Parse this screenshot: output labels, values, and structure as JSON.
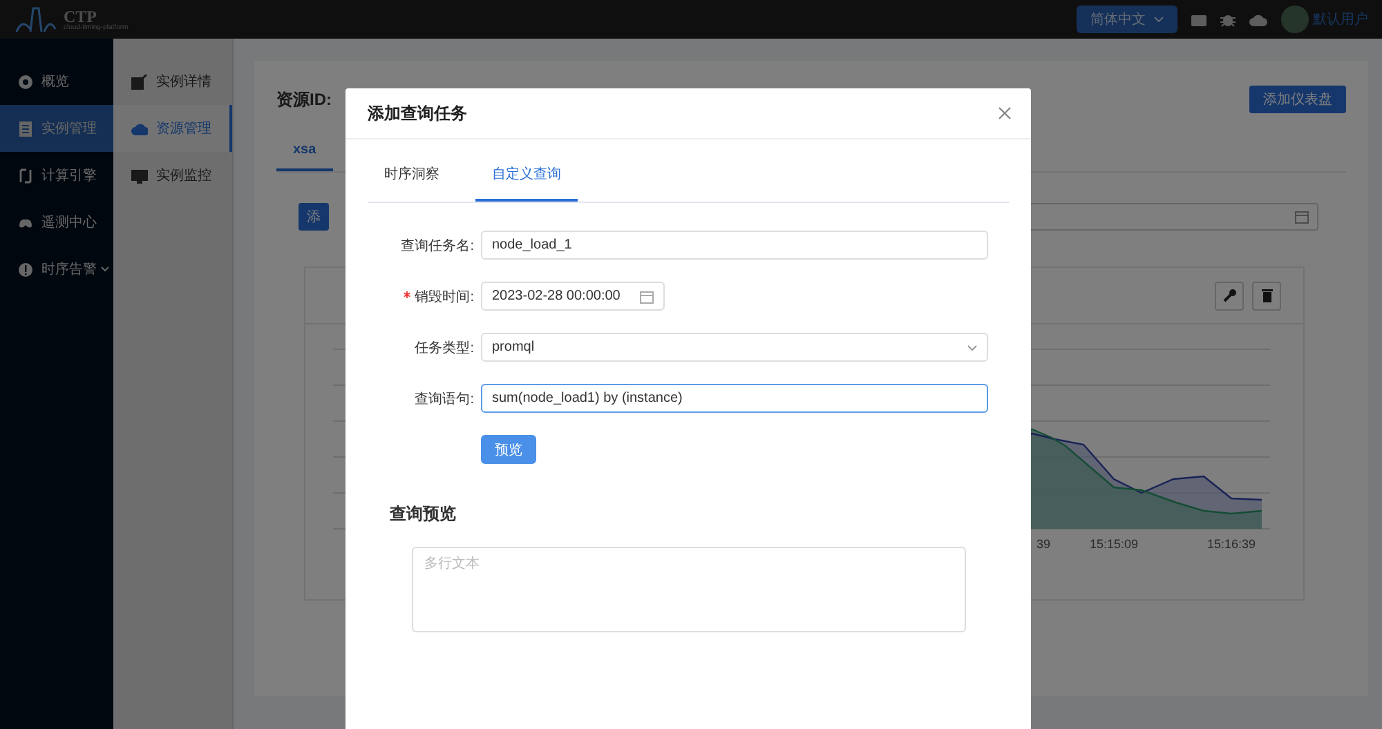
{
  "header": {
    "logo": {
      "title": "CTP",
      "subtitle": "cloud-timing-platform"
    },
    "language": "简体中文",
    "user": "默认用户"
  },
  "sidebar": {
    "items": [
      {
        "label": "概览",
        "selected": false,
        "has_submenu": false
      },
      {
        "label": "实例管理",
        "selected": true,
        "has_submenu": false
      },
      {
        "label": "计算引擎",
        "selected": false,
        "has_submenu": false
      },
      {
        "label": "遥测中心",
        "selected": false,
        "has_submenu": false
      },
      {
        "label": "时序告警",
        "selected": false,
        "has_submenu": true
      }
    ]
  },
  "subnav": {
    "items": [
      {
        "label": "实例详情",
        "selected": false
      },
      {
        "label": "资源管理",
        "selected": true
      },
      {
        "label": "实例监控",
        "selected": false
      }
    ]
  },
  "page": {
    "resource_id_label": "资源ID:",
    "dashboard_button": "添加仪表盘",
    "tabs": [
      {
        "label": "xsa",
        "selected": true
      }
    ],
    "add_button": "添",
    "chart": {
      "x_labels": [
        "39",
        "15:15:09",
        "15:16:39"
      ]
    }
  },
  "dialog": {
    "title": "添加查询任务",
    "tabs": [
      {
        "label": "时序洞察",
        "selected": false
      },
      {
        "label": "自定义查询",
        "selected": true
      }
    ],
    "fields": [
      {
        "kind": "text",
        "label": "查询任务名:",
        "value": "node_load_1",
        "required": false
      },
      {
        "kind": "date",
        "label": "销毁时间:",
        "value": "2023-02-28 00:00:00",
        "required": true
      },
      {
        "kind": "select",
        "label": "任务类型:",
        "value": "promql",
        "required": false
      },
      {
        "kind": "textarea",
        "label": "查询语句:",
        "value": "sum(node_load1) by (instance)",
        "required": false
      }
    ],
    "preview_button": "预览",
    "preview_heading": "查询预览",
    "preview_placeholder": "多行文本"
  }
}
